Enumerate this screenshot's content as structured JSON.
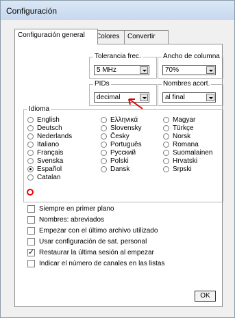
{
  "window": {
    "title": "Configuración"
  },
  "tabs": [
    "Configuración general",
    "Colores",
    "Convertir"
  ],
  "groups": {
    "tolerancia": {
      "label": "Tolerancia frec.",
      "value": "5 MHz"
    },
    "ancho": {
      "label": "Ancho de columna",
      "value": "70%"
    },
    "pids": {
      "label": "PIDs",
      "value": "decimal"
    },
    "nombres": {
      "label": "Nombres acort.",
      "value": "al final"
    }
  },
  "idioma": {
    "label": "Idioma",
    "col1": [
      "English",
      "Deutsch",
      "Nederlands",
      "Italiano",
      "Français",
      "Svenska",
      "Español",
      "Catalan"
    ],
    "col2": [
      "Ελληνικά",
      "Slovensky",
      "Česky",
      "Português",
      "Русский",
      "Polski",
      "Dansk"
    ],
    "col3": [
      "Magyar",
      "Türkçe",
      "Norsk",
      "Romana",
      "Suomalainen",
      "Hrvatski",
      "Srpski"
    ],
    "selected": "Español"
  },
  "checks": [
    {
      "label": "Siempre en primer plano",
      "checked": false
    },
    {
      "label": "Nombres: abreviados",
      "checked": false
    },
    {
      "label": "Empezar con el último archivo utilizado",
      "checked": false
    },
    {
      "label": "Usar configuración de sat. personal",
      "checked": false
    },
    {
      "label": "Restaurar la última sesión al empezar",
      "checked": true
    },
    {
      "label": "Indicar el número de canales en las listas",
      "checked": false
    }
  ],
  "ok_label": "OK",
  "annotation_color": "#e00000"
}
